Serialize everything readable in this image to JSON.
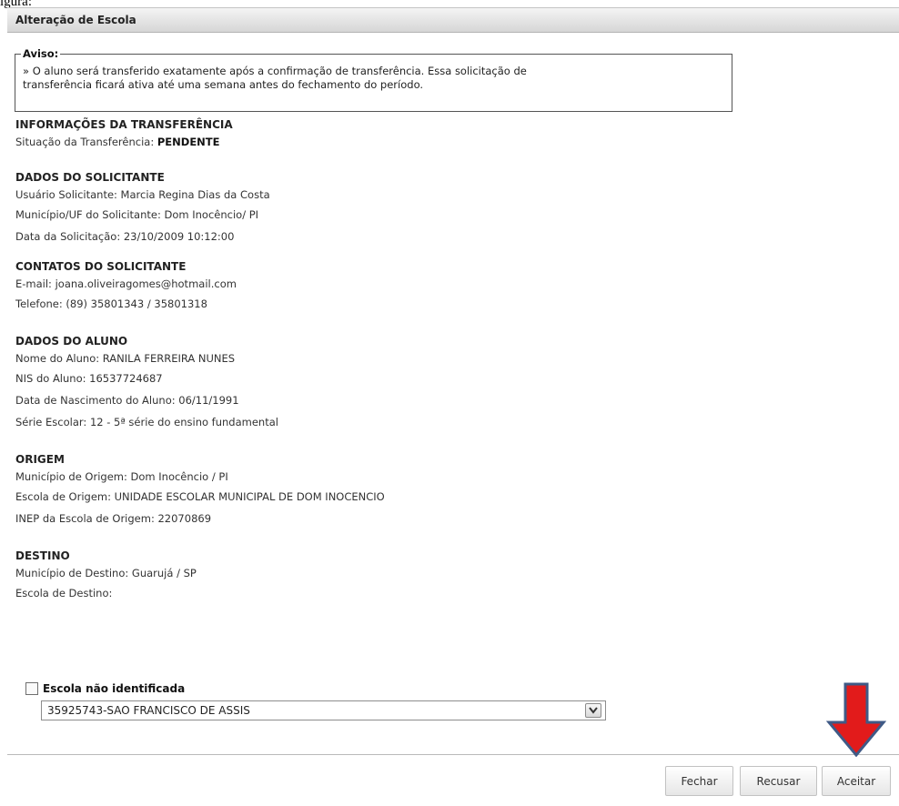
{
  "caption": "igura:",
  "dialog": {
    "title": "Alteração de Escola",
    "aviso": {
      "legend": "Aviso:",
      "line1": "» O aluno será transferido exatamente após a confirmação de transferência. Essa solicitação de",
      "line2": "transferência ficará ativa até uma semana antes do fechamento do período."
    },
    "info": {
      "title": "INFORMAÇÕES DA TRANSFERÊNCIA",
      "status_label": "Situação da Transferência: ",
      "status_value": "PENDENTE"
    },
    "solicitante": {
      "title": "DADOS DO SOLICITANTE",
      "usuario": "Usuário Solicitante: Marcia Regina Dias da Costa",
      "municipio": "Município/UF do Solicitante: Dom Inocêncio/ PI",
      "data": "Data da Solicitação: 23/10/2009 10:12:00"
    },
    "contatos": {
      "title": "CONTATOS DO SOLICITANTE",
      "email": "E-mail: joana.oliveiragomes@hotmail.com",
      "telefone": "Telefone: (89) 35801343 / 35801318"
    },
    "aluno": {
      "title": "DADOS DO ALUNO",
      "nome": "Nome do Aluno: RANILA FERREIRA NUNES",
      "nis": "NIS do Aluno: 16537724687",
      "nascimento": "Data de Nascimento do Aluno: 06/11/1991",
      "serie": "Série Escolar: 12 - 5ª série do ensino fundamental"
    },
    "origem": {
      "title": "ORIGEM",
      "municipio": "Município de Origem: Dom Inocêncio / PI",
      "escola": "Escola de Origem: UNIDADE ESCOLAR MUNICIPAL DE DOM INOCENCIO",
      "inep": "INEP da Escola de Origem: 22070869"
    },
    "destino": {
      "title": "DESTINO",
      "municipio": "Município de Destino: Guarujá / SP",
      "escola_label": "Escola de Destino:",
      "checkbox_label": "Escola não identificada",
      "checkbox_checked": false,
      "select_value": "35925743-SAO FRANCISCO DE ASSIS"
    },
    "buttons": {
      "fechar": "Fechar",
      "recusar": "Recusar",
      "aceitar": "Aceitar"
    }
  },
  "colors": {
    "arrow_indicator": "#e21b1b",
    "arrow_outline": "#3f5a86"
  }
}
